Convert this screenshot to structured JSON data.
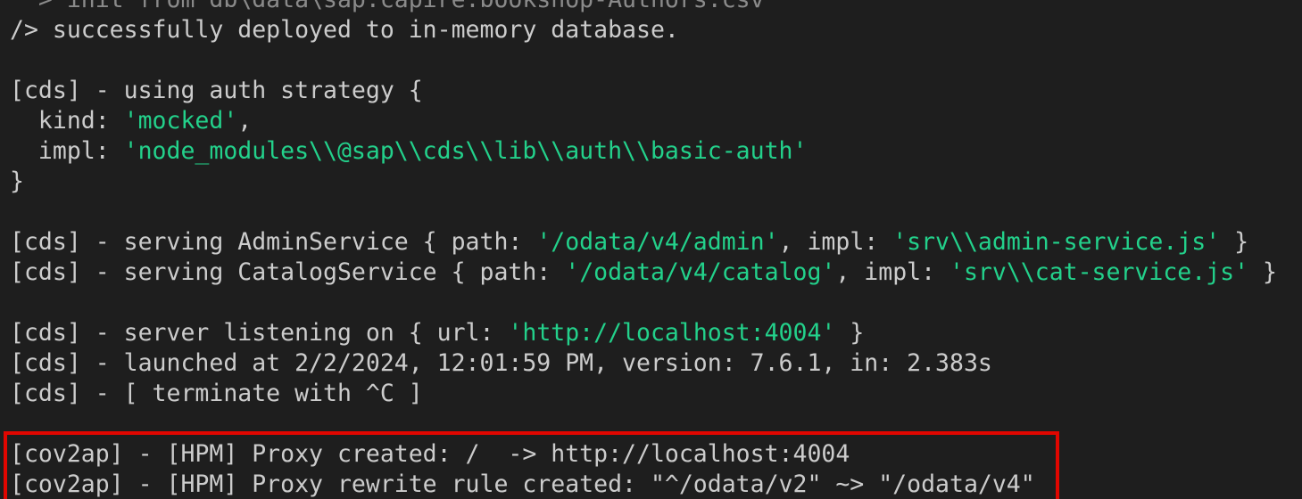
{
  "terminal": {
    "lines": [
      {
        "segments": [
          {
            "text": "  > init from db\\data\\sap.capire.bookshop-Authors.csv",
            "type": "dim"
          }
        ]
      },
      {
        "segments": [
          {
            "text": "/> successfully deployed to in-memory database.",
            "type": "plain"
          }
        ]
      },
      {
        "segments": [
          {
            "text": "",
            "type": "plain"
          }
        ]
      },
      {
        "segments": [
          {
            "text": "[cds] - using auth strategy {",
            "type": "plain"
          }
        ]
      },
      {
        "segments": [
          {
            "text": "  kind: ",
            "type": "plain"
          },
          {
            "text": "'mocked'",
            "type": "str"
          },
          {
            "text": ",",
            "type": "plain"
          }
        ]
      },
      {
        "segments": [
          {
            "text": "  impl: ",
            "type": "plain"
          },
          {
            "text": "'node_modules\\\\@sap\\\\cds\\\\lib\\\\auth\\\\basic-auth'",
            "type": "str"
          }
        ]
      },
      {
        "segments": [
          {
            "text": "}",
            "type": "plain"
          }
        ]
      },
      {
        "segments": [
          {
            "text": "",
            "type": "plain"
          }
        ]
      },
      {
        "segments": [
          {
            "text": "[cds] - serving AdminService { path: ",
            "type": "plain"
          },
          {
            "text": "'/odata/v4/admin'",
            "type": "str"
          },
          {
            "text": ", impl: ",
            "type": "plain"
          },
          {
            "text": "'srv\\\\admin-service.js'",
            "type": "str"
          },
          {
            "text": " }",
            "type": "plain"
          }
        ]
      },
      {
        "segments": [
          {
            "text": "[cds] - serving CatalogService { path: ",
            "type": "plain"
          },
          {
            "text": "'/odata/v4/catalog'",
            "type": "str"
          },
          {
            "text": ", impl: ",
            "type": "plain"
          },
          {
            "text": "'srv\\\\cat-service.js'",
            "type": "str"
          },
          {
            "text": " }",
            "type": "plain"
          }
        ]
      },
      {
        "segments": [
          {
            "text": "",
            "type": "plain"
          }
        ]
      },
      {
        "segments": [
          {
            "text": "[cds] - server listening on { url: ",
            "type": "plain"
          },
          {
            "text": "'http://localhost:4004'",
            "type": "str"
          },
          {
            "text": " }",
            "type": "plain"
          }
        ]
      },
      {
        "segments": [
          {
            "text": "[cds] - launched at 2/2/2024, 12:01:59 PM, version: 7.6.1, in: 2.383s",
            "type": "plain"
          }
        ]
      },
      {
        "segments": [
          {
            "text": "[cds] - [ terminate with ^C ]",
            "type": "plain"
          }
        ]
      },
      {
        "segments": [
          {
            "text": "",
            "type": "plain"
          }
        ]
      },
      {
        "segments": [
          {
            "text": "[cov2ap] - [HPM] Proxy created: /  -> http://localhost:4004",
            "type": "plain"
          }
        ]
      },
      {
        "segments": [
          {
            "text": "[cov2ap] - [HPM] Proxy rewrite rule created: \"^/odata/v2\" ~> \"/odata/v4\"",
            "type": "plain"
          }
        ]
      }
    ]
  },
  "colors": {
    "background": "#1e1e1e",
    "foreground": "#cccccc",
    "string": "#23d18b",
    "highlight_border": "#e10600"
  }
}
